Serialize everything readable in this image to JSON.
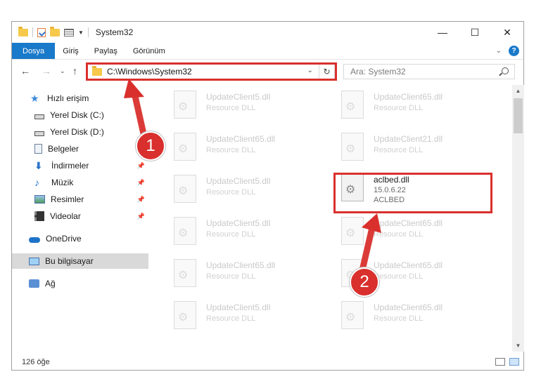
{
  "window": {
    "title": "System32",
    "controls": {
      "minimize": "—",
      "maximize": "☐",
      "close": "✕"
    }
  },
  "ribbon": {
    "tabs": [
      "Dosya",
      "Giriş",
      "Paylaş",
      "Görünüm"
    ],
    "help_label": "?"
  },
  "address": {
    "path": "C:\\Windows\\System32",
    "search_placeholder": "Ara: System32"
  },
  "sidebar": {
    "items": [
      {
        "label": "Hızlı erişim",
        "icon": "star-icon"
      },
      {
        "label": "Yerel Disk (C:)",
        "icon": "disk-icon"
      },
      {
        "label": "Yerel Disk (D:)",
        "icon": "disk-icon"
      },
      {
        "label": "Belgeler",
        "icon": "documents-icon"
      },
      {
        "label": "İndirmeler",
        "icon": "download-icon"
      },
      {
        "label": "Müzik",
        "icon": "music-icon"
      },
      {
        "label": "Resimler",
        "icon": "pictures-icon"
      },
      {
        "label": "Videolar",
        "icon": "videos-icon"
      },
      {
        "label": "OneDrive",
        "icon": "cloud-icon"
      },
      {
        "label": "Bu bilgisayar",
        "icon": "computer-icon"
      },
      {
        "label": "Ağ",
        "icon": "network-icon"
      }
    ]
  },
  "files": [
    {
      "name": "UpdateClient5.dll",
      "desc": "Resource DLL"
    },
    {
      "name": "UpdateClient65.dll",
      "desc": "Resource DLL"
    },
    {
      "name": "UpdateClient65.dll",
      "desc": "Resource DLL"
    },
    {
      "name": "UpdateClient21.dll",
      "desc": "Resource DLL"
    },
    {
      "name": "UpdateClient5.dll",
      "desc": "Resource DLL"
    },
    {
      "name": "aclbed.dll",
      "version": "15.0.6.22",
      "desc": "ACLBED"
    },
    {
      "name": "UpdateClient5.dll",
      "desc": "Resource DLL"
    },
    {
      "name": "UpdateClient65.dll",
      "desc": "Resource DLL"
    },
    {
      "name": "UpdateClient65.dll",
      "desc": "Resource DLL"
    },
    {
      "name": "UpdateClient65.dll",
      "desc": "Resource DLL"
    },
    {
      "name": "UpdateClient5.dll",
      "desc": "Resource DLL"
    },
    {
      "name": "UpdateClient65.dll",
      "desc": "Resource DLL"
    }
  ],
  "status": {
    "count": "126 öğe"
  },
  "annotations": {
    "step1": "1",
    "step2": "2",
    "color": "#d9302d"
  },
  "colors": {
    "accent": "#1979ca",
    "highlight": "#d9302d"
  }
}
